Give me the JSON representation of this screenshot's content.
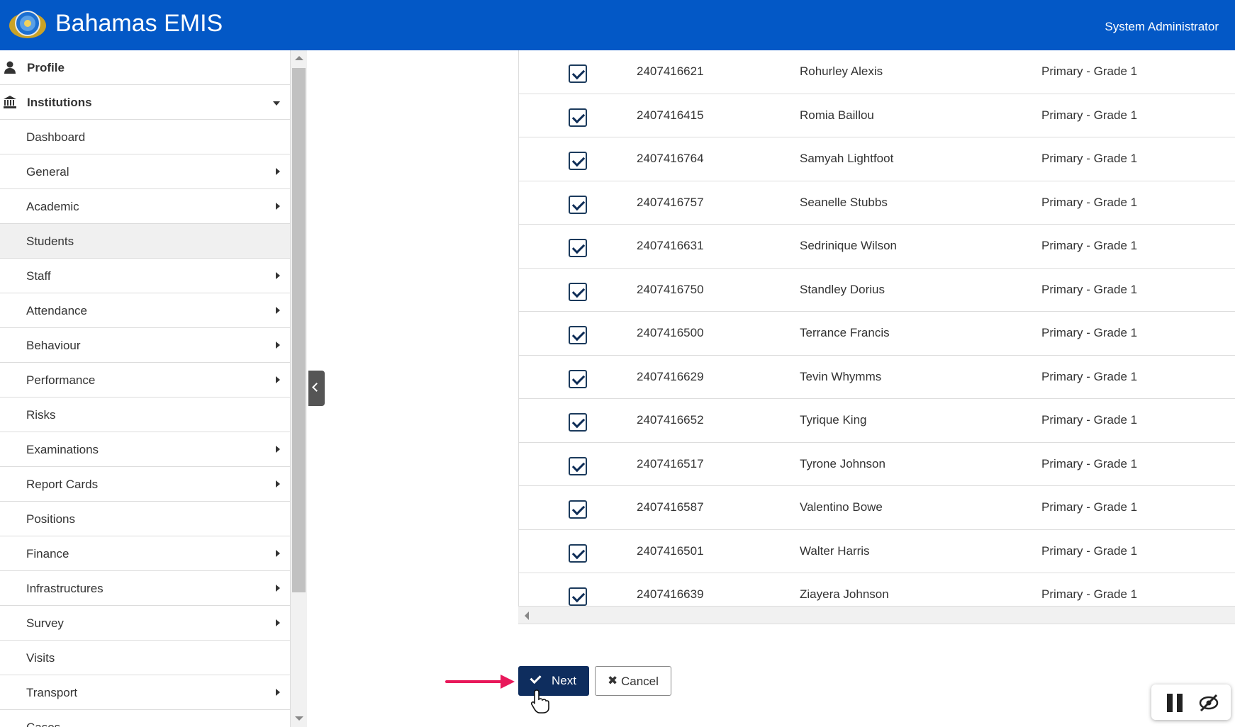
{
  "header": {
    "title": "Bahamas EMIS",
    "user": "System Administrator",
    "colors": {
      "bar": "#0358c6"
    }
  },
  "sidebar": {
    "items": [
      {
        "label": "Profile",
        "icon": "user-icon",
        "top": true
      },
      {
        "label": "Institutions",
        "icon": "institution-icon",
        "top": true,
        "expanded": true
      },
      {
        "label": "Dashboard"
      },
      {
        "label": "General",
        "submenu": true
      },
      {
        "label": "Academic",
        "submenu": true
      },
      {
        "label": "Students",
        "active": true
      },
      {
        "label": "Staff",
        "submenu": true
      },
      {
        "label": "Attendance",
        "submenu": true
      },
      {
        "label": "Behaviour",
        "submenu": true
      },
      {
        "label": "Performance",
        "submenu": true
      },
      {
        "label": "Risks"
      },
      {
        "label": "Examinations",
        "submenu": true
      },
      {
        "label": "Report Cards",
        "submenu": true
      },
      {
        "label": "Positions"
      },
      {
        "label": "Finance",
        "submenu": true
      },
      {
        "label": "Infrastructures",
        "submenu": true
      },
      {
        "label": "Survey",
        "submenu": true
      },
      {
        "label": "Visits"
      },
      {
        "label": "Transport",
        "submenu": true
      },
      {
        "label": "Cases"
      }
    ]
  },
  "students": {
    "rows": [
      {
        "checked": true,
        "id": "2407416621",
        "name": "Rohurley Alexis",
        "grade": "Primary - Grade 1"
      },
      {
        "checked": true,
        "id": "2407416415",
        "name": "Romia Baillou",
        "grade": "Primary - Grade 1"
      },
      {
        "checked": true,
        "id": "2407416764",
        "name": "Samyah Lightfoot",
        "grade": "Primary - Grade 1"
      },
      {
        "checked": true,
        "id": "2407416757",
        "name": "Seanelle Stubbs",
        "grade": "Primary - Grade 1"
      },
      {
        "checked": true,
        "id": "2407416631",
        "name": "Sedrinique Wilson",
        "grade": "Primary - Grade 1"
      },
      {
        "checked": true,
        "id": "2407416750",
        "name": "Standley Dorius",
        "grade": "Primary - Grade 1"
      },
      {
        "checked": true,
        "id": "2407416500",
        "name": "Terrance Francis",
        "grade": "Primary - Grade 1"
      },
      {
        "checked": true,
        "id": "2407416629",
        "name": "Tevin Whymms",
        "grade": "Primary - Grade 1"
      },
      {
        "checked": true,
        "id": "2407416652",
        "name": "Tyrique King",
        "grade": "Primary - Grade 1"
      },
      {
        "checked": true,
        "id": "2407416517",
        "name": "Tyrone Johnson",
        "grade": "Primary - Grade 1"
      },
      {
        "checked": true,
        "id": "2407416587",
        "name": "Valentino Bowe",
        "grade": "Primary - Grade 1"
      },
      {
        "checked": true,
        "id": "2407416501",
        "name": "Walter Harris",
        "grade": "Primary - Grade 1"
      },
      {
        "checked": true,
        "id": "2407416639",
        "name": "Ziayera Johnson",
        "grade": "Primary - Grade 1"
      }
    ]
  },
  "actions": {
    "next_label": "Next",
    "cancel_label": "Cancel",
    "next_color": "#0e2d5e"
  },
  "annotation": {
    "arrow_color": "#e8185a"
  }
}
